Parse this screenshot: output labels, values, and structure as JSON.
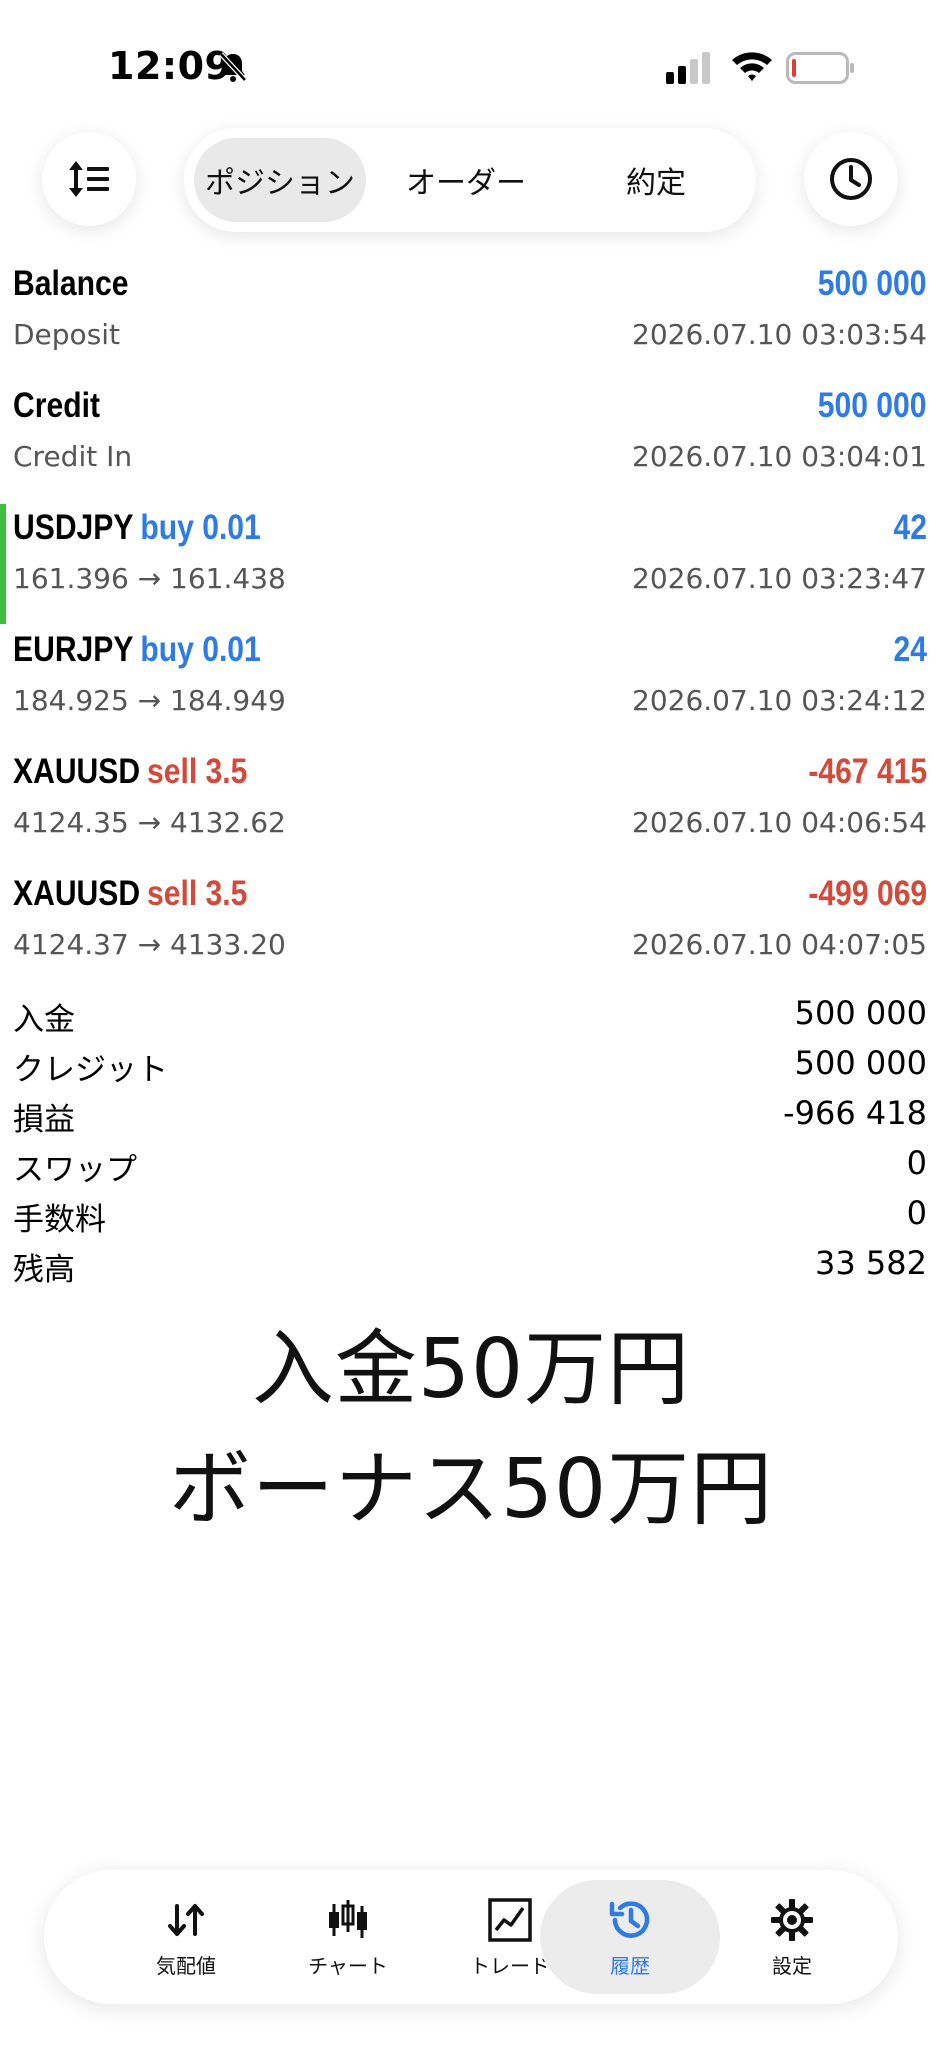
{
  "status_bar": {
    "time": "12:09"
  },
  "tabs": [
    "ポジション",
    "オーダー",
    "約定"
  ],
  "deals": [
    {
      "symbol": "Balance",
      "direction": "",
      "value": "500 000",
      "value_color": "blue",
      "sub": "Deposit",
      "time": "2026.07.10 03:03:54",
      "marker": false
    },
    {
      "symbol": "Credit",
      "direction": "",
      "value": "500 000",
      "value_color": "blue",
      "sub": "Credit In",
      "time": "2026.07.10 03:04:01",
      "marker": false
    },
    {
      "symbol": "USDJPY",
      "direction": "buy 0.01",
      "value": "42",
      "value_color": "blue",
      "sub": "161.396 → 161.438",
      "time": "2026.07.10 03:23:47",
      "marker": true
    },
    {
      "symbol": "EURJPY",
      "direction": "buy 0.01",
      "value": "24",
      "value_color": "blue",
      "sub": "184.925 → 184.949",
      "time": "2026.07.10 03:24:12",
      "marker": false
    },
    {
      "symbol": "XAUUSD",
      "direction": "sell 3.5",
      "value": "-467 415",
      "value_color": "red",
      "sub": "4124.35 → 4132.62",
      "time": "2026.07.10 04:06:54",
      "marker": false
    },
    {
      "symbol": "XAUUSD",
      "direction": "sell 3.5",
      "value": "-499 069",
      "value_color": "red",
      "sub": "4124.37 → 4133.20",
      "time": "2026.07.10 04:07:05",
      "marker": false
    }
  ],
  "summary": [
    {
      "label": "入金",
      "value": "500 000"
    },
    {
      "label": "クレジット",
      "value": "500 000"
    },
    {
      "label": "損益",
      "value": "-966 418"
    },
    {
      "label": "スワップ",
      "value": "0"
    },
    {
      "label": "手数料",
      "value": "0"
    },
    {
      "label": "残高",
      "value": "33 582"
    }
  ],
  "caption": {
    "line1": "入金50万円",
    "line2": "ボーナス50万円"
  },
  "nav": [
    {
      "label": "気配値",
      "icon": "quotes-icon",
      "active": false
    },
    {
      "label": "チャート",
      "icon": "chart-candles-icon",
      "active": false
    },
    {
      "label": "トレード",
      "icon": "trade-chart-icon",
      "active": false
    },
    {
      "label": "履歴",
      "icon": "history-icon",
      "active": true
    },
    {
      "label": "設定",
      "icon": "settings-gear-icon",
      "active": false
    }
  ],
  "colors": {
    "accent_blue": "#2f7be6",
    "loss_red": "#d24a3a",
    "marker_green": "#3fbf3f"
  }
}
